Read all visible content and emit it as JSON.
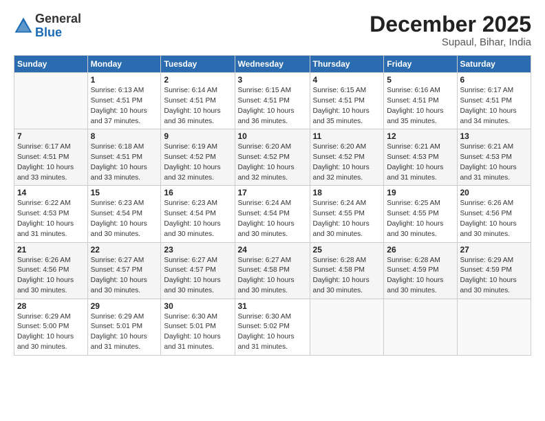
{
  "logo": {
    "general": "General",
    "blue": "Blue"
  },
  "header": {
    "month": "December 2025",
    "location": "Supaul, Bihar, India"
  },
  "days_of_week": [
    "Sunday",
    "Monday",
    "Tuesday",
    "Wednesday",
    "Thursday",
    "Friday",
    "Saturday"
  ],
  "weeks": [
    [
      {
        "day": "",
        "info": ""
      },
      {
        "day": "1",
        "info": "Sunrise: 6:13 AM\nSunset: 4:51 PM\nDaylight: 10 hours\nand 37 minutes."
      },
      {
        "day": "2",
        "info": "Sunrise: 6:14 AM\nSunset: 4:51 PM\nDaylight: 10 hours\nand 36 minutes."
      },
      {
        "day": "3",
        "info": "Sunrise: 6:15 AM\nSunset: 4:51 PM\nDaylight: 10 hours\nand 36 minutes."
      },
      {
        "day": "4",
        "info": "Sunrise: 6:15 AM\nSunset: 4:51 PM\nDaylight: 10 hours\nand 35 minutes."
      },
      {
        "day": "5",
        "info": "Sunrise: 6:16 AM\nSunset: 4:51 PM\nDaylight: 10 hours\nand 35 minutes."
      },
      {
        "day": "6",
        "info": "Sunrise: 6:17 AM\nSunset: 4:51 PM\nDaylight: 10 hours\nand 34 minutes."
      }
    ],
    [
      {
        "day": "7",
        "info": "Sunrise: 6:17 AM\nSunset: 4:51 PM\nDaylight: 10 hours\nand 33 minutes."
      },
      {
        "day": "8",
        "info": "Sunrise: 6:18 AM\nSunset: 4:51 PM\nDaylight: 10 hours\nand 33 minutes."
      },
      {
        "day": "9",
        "info": "Sunrise: 6:19 AM\nSunset: 4:52 PM\nDaylight: 10 hours\nand 32 minutes."
      },
      {
        "day": "10",
        "info": "Sunrise: 6:20 AM\nSunset: 4:52 PM\nDaylight: 10 hours\nand 32 minutes."
      },
      {
        "day": "11",
        "info": "Sunrise: 6:20 AM\nSunset: 4:52 PM\nDaylight: 10 hours\nand 32 minutes."
      },
      {
        "day": "12",
        "info": "Sunrise: 6:21 AM\nSunset: 4:53 PM\nDaylight: 10 hours\nand 31 minutes."
      },
      {
        "day": "13",
        "info": "Sunrise: 6:21 AM\nSunset: 4:53 PM\nDaylight: 10 hours\nand 31 minutes."
      }
    ],
    [
      {
        "day": "14",
        "info": "Sunrise: 6:22 AM\nSunset: 4:53 PM\nDaylight: 10 hours\nand 31 minutes."
      },
      {
        "day": "15",
        "info": "Sunrise: 6:23 AM\nSunset: 4:54 PM\nDaylight: 10 hours\nand 30 minutes."
      },
      {
        "day": "16",
        "info": "Sunrise: 6:23 AM\nSunset: 4:54 PM\nDaylight: 10 hours\nand 30 minutes."
      },
      {
        "day": "17",
        "info": "Sunrise: 6:24 AM\nSunset: 4:54 PM\nDaylight: 10 hours\nand 30 minutes."
      },
      {
        "day": "18",
        "info": "Sunrise: 6:24 AM\nSunset: 4:55 PM\nDaylight: 10 hours\nand 30 minutes."
      },
      {
        "day": "19",
        "info": "Sunrise: 6:25 AM\nSunset: 4:55 PM\nDaylight: 10 hours\nand 30 minutes."
      },
      {
        "day": "20",
        "info": "Sunrise: 6:26 AM\nSunset: 4:56 PM\nDaylight: 10 hours\nand 30 minutes."
      }
    ],
    [
      {
        "day": "21",
        "info": "Sunrise: 6:26 AM\nSunset: 4:56 PM\nDaylight: 10 hours\nand 30 minutes."
      },
      {
        "day": "22",
        "info": "Sunrise: 6:27 AM\nSunset: 4:57 PM\nDaylight: 10 hours\nand 30 minutes."
      },
      {
        "day": "23",
        "info": "Sunrise: 6:27 AM\nSunset: 4:57 PM\nDaylight: 10 hours\nand 30 minutes."
      },
      {
        "day": "24",
        "info": "Sunrise: 6:27 AM\nSunset: 4:58 PM\nDaylight: 10 hours\nand 30 minutes."
      },
      {
        "day": "25",
        "info": "Sunrise: 6:28 AM\nSunset: 4:58 PM\nDaylight: 10 hours\nand 30 minutes."
      },
      {
        "day": "26",
        "info": "Sunrise: 6:28 AM\nSunset: 4:59 PM\nDaylight: 10 hours\nand 30 minutes."
      },
      {
        "day": "27",
        "info": "Sunrise: 6:29 AM\nSunset: 4:59 PM\nDaylight: 10 hours\nand 30 minutes."
      }
    ],
    [
      {
        "day": "28",
        "info": "Sunrise: 6:29 AM\nSunset: 5:00 PM\nDaylight: 10 hours\nand 30 minutes."
      },
      {
        "day": "29",
        "info": "Sunrise: 6:29 AM\nSunset: 5:01 PM\nDaylight: 10 hours\nand 31 minutes."
      },
      {
        "day": "30",
        "info": "Sunrise: 6:30 AM\nSunset: 5:01 PM\nDaylight: 10 hours\nand 31 minutes."
      },
      {
        "day": "31",
        "info": "Sunrise: 6:30 AM\nSunset: 5:02 PM\nDaylight: 10 hours\nand 31 minutes."
      },
      {
        "day": "",
        "info": ""
      },
      {
        "day": "",
        "info": ""
      },
      {
        "day": "",
        "info": ""
      }
    ]
  ]
}
